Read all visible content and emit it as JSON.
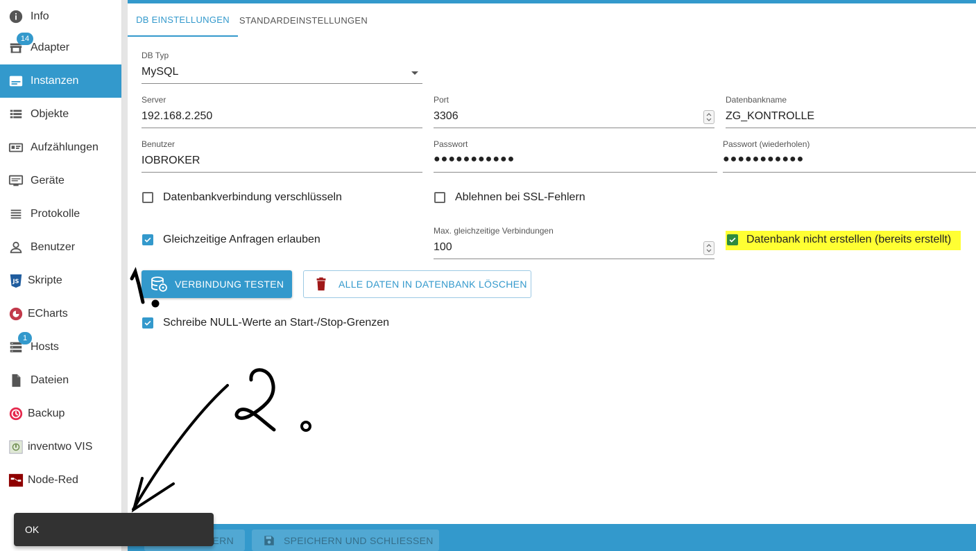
{
  "sidebar": {
    "items": [
      {
        "label": "Info",
        "icon": "info-icon",
        "active": false
      },
      {
        "label": "Adapter",
        "icon": "store-icon",
        "active": false,
        "badge": "14"
      },
      {
        "label": "Instanzen",
        "icon": "instances-icon",
        "active": true
      },
      {
        "label": "Objekte",
        "icon": "list-icon",
        "active": false
      },
      {
        "label": "Aufzählungen",
        "icon": "enum-card-icon",
        "active": false
      },
      {
        "label": "Geräte",
        "icon": "devices-icon",
        "active": false
      },
      {
        "label": "Protokolle",
        "icon": "log-lines-icon",
        "active": false
      },
      {
        "label": "Benutzer",
        "icon": "user-icon",
        "active": false
      },
      {
        "label": "Skripte",
        "icon": "javascript-icon",
        "active": false
      },
      {
        "label": "ECharts",
        "icon": "echarts-icon",
        "active": false
      },
      {
        "label": "Hosts",
        "icon": "server-icon",
        "active": false,
        "badge": "1"
      },
      {
        "label": "Dateien",
        "icon": "file-icon",
        "active": false
      },
      {
        "label": "Backup",
        "icon": "backup-icon",
        "active": false
      },
      {
        "label": "inventwo VIS",
        "icon": "inventwo-icon",
        "active": false
      },
      {
        "label": "Node-Red",
        "icon": "node-red-icon",
        "active": false
      }
    ]
  },
  "tabs": [
    {
      "label": "DB EINSTELLUNGEN",
      "active": true
    },
    {
      "label": "STANDARDEINSTELLUNGEN",
      "active": false
    }
  ],
  "form": {
    "db_type": {
      "label": "DB Typ",
      "value": "MySQL"
    },
    "server": {
      "label": "Server",
      "value": "192.168.2.250"
    },
    "port": {
      "label": "Port",
      "value": "3306"
    },
    "dbname": {
      "label": "Datenbankname",
      "value": "ZG_KONTROLLE"
    },
    "user": {
      "label": "Benutzer",
      "value": "IOBROKER"
    },
    "password": {
      "label": "Passwort",
      "value": "●●●●●●●●●●●"
    },
    "password_repeat": {
      "label": "Passwort (wiederholen)",
      "value": "●●●●●●●●●●●"
    },
    "encrypt": {
      "label": "Datenbankverbindung verschlüsseln",
      "checked": false
    },
    "reject_ssl": {
      "label": "Ablehnen bei SSL-Fehlern",
      "checked": false
    },
    "parallel": {
      "label": "Gleichzeitige Anfragen erlauben",
      "checked": true
    },
    "max_conn": {
      "label": "Max. gleichzeitige Verbindungen",
      "value": "100"
    },
    "no_create": {
      "label": "Datenbank nicht erstellen (bereits erstellt)",
      "checked": true
    },
    "write_null": {
      "label": "Schreibe NULL-Werte an Start-/Stop-Grenzen",
      "checked": true
    }
  },
  "buttons": {
    "test": "VERBINDUNG TESTEN",
    "delete_all": "ALLE DATEN IN DATENBANK LÖSCHEN"
  },
  "bottombar": {
    "save": "ERN",
    "save_close": "SPEICHERN UND SCHLIESSEN"
  },
  "snackbar": {
    "text": "OK"
  },
  "colors": {
    "accent": "#3399cc",
    "highlight": "#ffff33",
    "delete_icon": "#a01818",
    "snackbar": "#323232"
  }
}
